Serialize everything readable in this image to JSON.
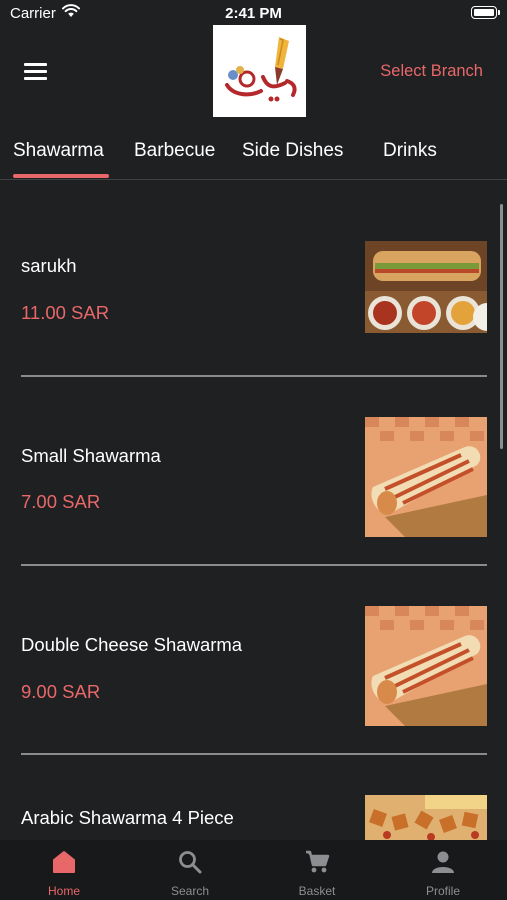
{
  "status_bar": {
    "carrier": "Carrier",
    "time": "2:41 PM"
  },
  "header": {
    "select_branch": "Select Branch",
    "logo_text": "رايق"
  },
  "tabs": [
    {
      "label": "Shawarma",
      "active": true
    },
    {
      "label": "Barbecue",
      "active": false
    },
    {
      "label": "Side Dishes",
      "active": false
    },
    {
      "label": "Drinks",
      "active": false
    }
  ],
  "items": [
    {
      "name": "sarukh",
      "price": "11.00 SAR",
      "image": "sandwich-with-dips-image"
    },
    {
      "name": "Small Shawarma",
      "price": "7.00 SAR",
      "image": "shawarma-wrap-image"
    },
    {
      "name": "Double Cheese Shawarma",
      "price": "9.00 SAR",
      "image": "shawarma-wrap-image"
    },
    {
      "name": "Arabic Shawarma 4 Piece",
      "price": "",
      "image": "arabic-shawarma-pieces-image"
    }
  ],
  "tabbar": [
    {
      "label": "Home",
      "icon": "home-icon",
      "active": true
    },
    {
      "label": "Search",
      "icon": "search-icon",
      "active": false
    },
    {
      "label": "Basket",
      "icon": "cart-icon",
      "active": false
    },
    {
      "label": "Profile",
      "icon": "profile-icon",
      "active": false
    }
  ],
  "colors": {
    "accent": "#e8686a",
    "background": "#1f2022",
    "tabbar": "#18191a"
  }
}
